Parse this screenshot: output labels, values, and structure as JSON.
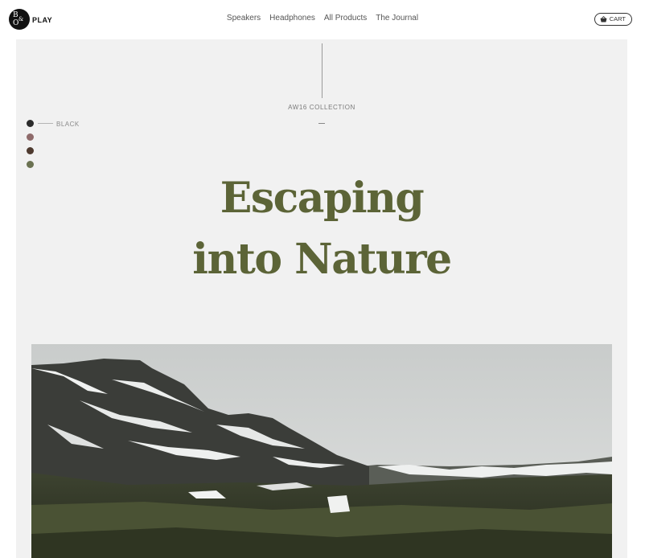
{
  "brand": {
    "logo_lines": [
      "B",
      "&",
      "O"
    ],
    "wordmark": "PLAY"
  },
  "nav": {
    "items": [
      "Speakers",
      "Headphones",
      "All Products",
      "The Journal"
    ]
  },
  "cart": {
    "icon": "basket-icon",
    "label": "CART"
  },
  "hero": {
    "collection": "AW16 COLLECTION",
    "headline_line1": "Escaping",
    "headline_line2": "into Nature",
    "colors": {
      "background": "#f1f1f1",
      "headline": "#5c6437"
    },
    "swatches": [
      {
        "color": "#2b2b2b",
        "label": "BLACK",
        "selected": true
      },
      {
        "color": "#8e6a6a",
        "selected": false
      },
      {
        "color": "#4e3a2f",
        "selected": false
      },
      {
        "color": "#6b7252",
        "selected": false
      }
    ],
    "image": {
      "subject": "snow-capped mountain landscape"
    }
  }
}
